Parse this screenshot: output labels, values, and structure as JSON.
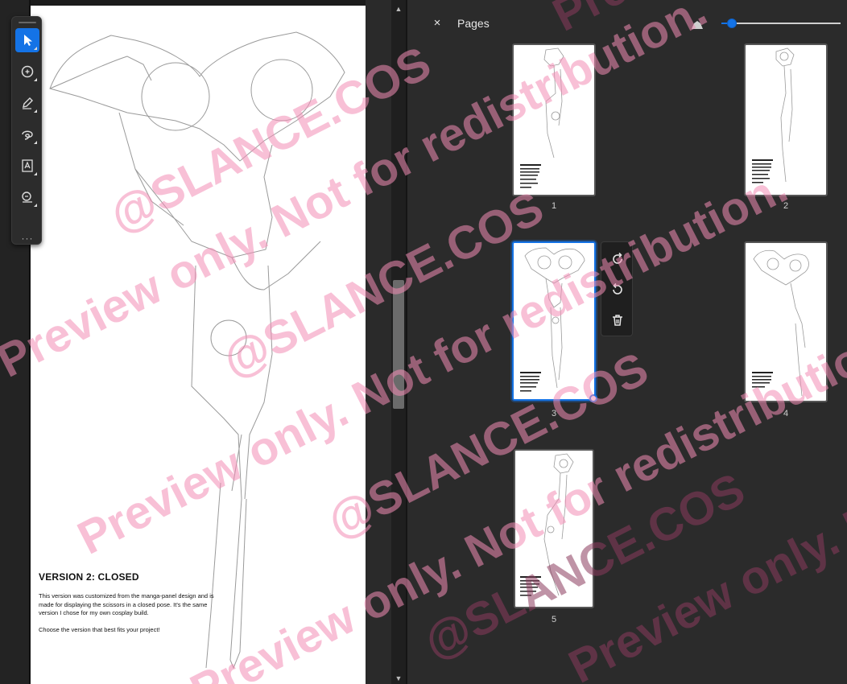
{
  "document": {
    "heading": "VERSION 2: CLOSED",
    "paragraph_1": "This version was customized from the manga-panel design and is made for displaying the scissors in a closed pose. It's the same version I chose for my own cosplay build.",
    "paragraph_2": "Choose the version that best fits your project!"
  },
  "tools": {
    "items": [
      {
        "name": "select-tool",
        "icon": "cursor-icon"
      },
      {
        "name": "comment-tool",
        "icon": "comment-icon"
      },
      {
        "name": "draw-tool",
        "icon": "pen-icon"
      },
      {
        "name": "freehand-tool",
        "icon": "lasso-icon"
      },
      {
        "name": "text-tool",
        "icon": "text-box-icon"
      },
      {
        "name": "sign-tool",
        "icon": "sign-icon"
      }
    ],
    "more_label": "···"
  },
  "pages_panel": {
    "title": "Pages",
    "close_label": "×",
    "thumbnails": [
      {
        "label": "1"
      },
      {
        "label": "2"
      },
      {
        "label": "3",
        "selected": true
      },
      {
        "label": "4"
      },
      {
        "label": "5"
      }
    ],
    "zoom_level": 0.05
  },
  "page_actions": [
    {
      "name": "rotate-clockwise-button",
      "icon": "rotate-cw-icon"
    },
    {
      "name": "rotate-counterclockwise-button",
      "icon": "rotate-ccw-icon"
    },
    {
      "name": "delete-page-button",
      "icon": "trash-icon"
    }
  ],
  "watermark": {
    "line_a": "@SLANCE.COS",
    "line_b": "Preview only. Not for redistribution."
  },
  "colors": {
    "accent": "#1473e6",
    "panel_bg": "#2b2b2b",
    "watermark_pink": "#f28cb4",
    "watermark_dark": "#8a3a5c"
  }
}
